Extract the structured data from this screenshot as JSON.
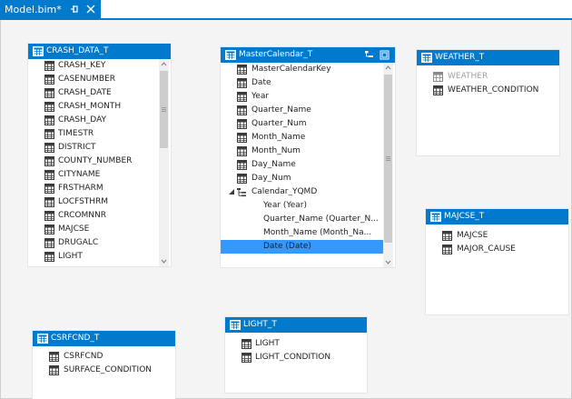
{
  "tab": {
    "title": "Model.bim*"
  },
  "tables": {
    "crash_data": {
      "name": "CRASH_DATA_T",
      "columns": [
        "CRASH_KEY",
        "CASENUMBER",
        "CRASH_DATE",
        "CRASH_MONTH",
        "CRASH_DAY",
        "TIMESTR",
        "DISTRICT",
        "COUNTY_NUMBER",
        "CITYNAME",
        "FRSTHARM",
        "LOCFSTHRM",
        "CRCOMNNR",
        "MAJCSE",
        "DRUGALC",
        "LIGHT"
      ]
    },
    "master_calendar": {
      "name": "MasterCalendar_T",
      "columns": [
        "MasterCalendarKey",
        "Date",
        "Year",
        "Quarter_Name",
        "Quarter_Num",
        "Month_Name",
        "Month_Num",
        "Day_Name",
        "Day_Num"
      ],
      "hierarchy": {
        "name": "Calendar_YQMD",
        "levels": [
          "Year (Year)",
          "Quarter_Name (Quarter_N...",
          "Month_Name (Month_Na...",
          "Date (Date)"
        ]
      }
    },
    "weather": {
      "name": "WEATHER_T",
      "columns": [
        "WEATHER",
        "WEATHER_CONDITION"
      ]
    },
    "majcse": {
      "name": "MAJCSE_T",
      "columns": [
        "MAJCSE",
        "MAJOR_CAUSE"
      ]
    },
    "csrfcnd": {
      "name": "CSRFCND_T",
      "columns": [
        "CSRFCND",
        "SURFACE_CONDITION"
      ]
    },
    "light": {
      "name": "LIGHT_T",
      "columns": [
        "LIGHT",
        "LIGHT_CONDITION"
      ]
    }
  },
  "colors": {
    "accent": "#007acc",
    "selection": "#3399ff",
    "canvas": "#f4f4f4"
  },
  "icons": {
    "table": "table-grid-icon",
    "column": "column-icon",
    "hierarchy": "hierarchy-icon",
    "pin": "pin-icon",
    "close": "close-icon"
  }
}
